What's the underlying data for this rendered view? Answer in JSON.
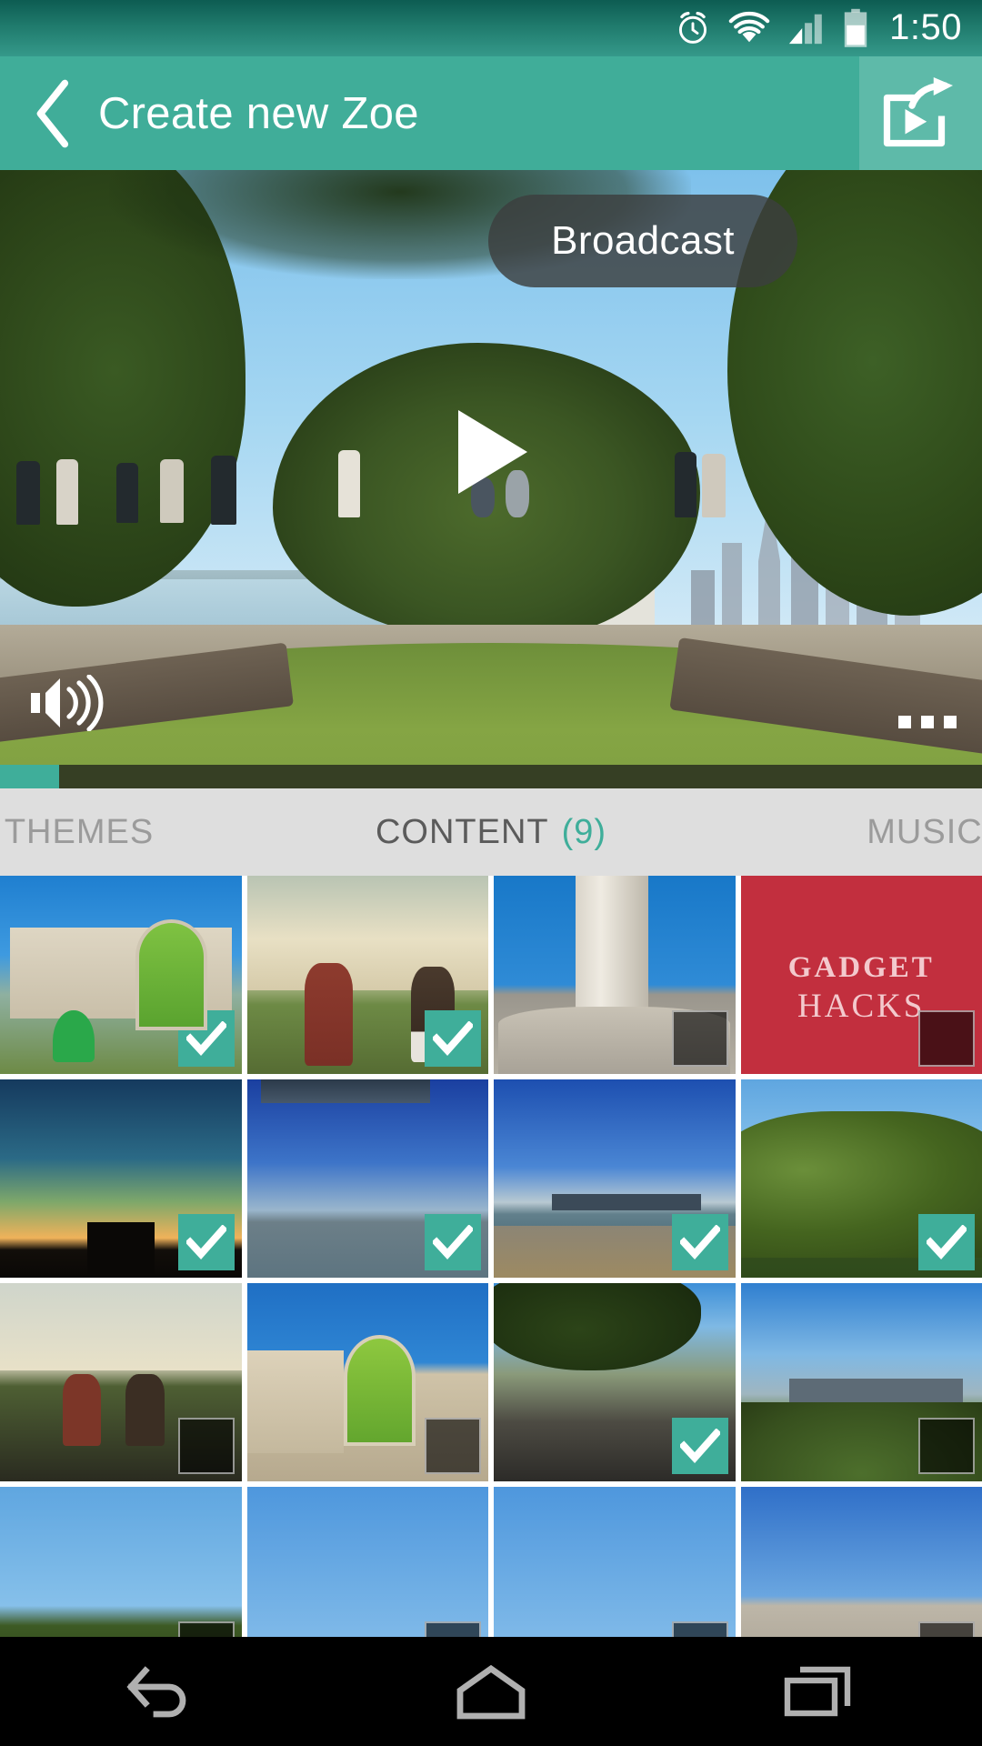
{
  "status_bar": {
    "time": "1:50",
    "icons": [
      "alarm-icon",
      "wifi-icon",
      "cellular-signal-icon",
      "battery-icon"
    ]
  },
  "action_bar": {
    "back_label": "back-arrow-icon",
    "title": "Create new Zoe",
    "broadcast_icon": "broadcast-share-icon"
  },
  "preview": {
    "tooltip": "Broadcast",
    "play_icon": "play-icon",
    "volume_icon": "volume-on-icon",
    "more_icon": "more-options-icon",
    "progress_percent": 6
  },
  "tabs": [
    {
      "label": "THEMES",
      "count": "",
      "selected": false
    },
    {
      "label": "CONTENT",
      "count": "(9)",
      "selected": true
    },
    {
      "label": "MUSIC",
      "count": "",
      "selected": false
    }
  ],
  "accent_color": "#3fae9a",
  "action_bar_color": "#40ad99",
  "grid": {
    "items": [
      {
        "name": "android-hq-green-droid",
        "scene": "t-hq",
        "selected": true
      },
      {
        "name": "kitkat-droid-statues",
        "scene": "t-droids",
        "selected": true
      },
      {
        "name": "coit-tower-monument",
        "scene": "t-monument",
        "selected": false
      },
      {
        "name": "gadget-hacks-logo",
        "scene": "t-gh",
        "selected": false
      },
      {
        "name": "night-sunset-skyline",
        "scene": "t-night",
        "selected": true
      },
      {
        "name": "san-francisco-bay-city",
        "scene": "t-city1",
        "selected": true
      },
      {
        "name": "bay-bridge-rocks-shore",
        "scene": "t-city2",
        "selected": true
      },
      {
        "name": "cypress-trees",
        "scene": "t-trees",
        "selected": true
      },
      {
        "name": "droid-statues-lawn",
        "scene": "t-droids2",
        "selected": false
      },
      {
        "name": "android-hq-entrance",
        "scene": "t-hq2",
        "selected": false
      },
      {
        "name": "tree-lined-street",
        "scene": "t-street",
        "selected": true
      },
      {
        "name": "city-skyline-hill",
        "scene": "t-skyline",
        "selected": false
      },
      {
        "name": "partial-row-item-1",
        "scene": "t-row4a",
        "selected": false
      },
      {
        "name": "partial-row-item-2",
        "scene": "t-row4b",
        "selected": false
      },
      {
        "name": "partial-row-item-3",
        "scene": "t-row4c",
        "selected": false
      },
      {
        "name": "partial-row-item-4",
        "scene": "t-row4d",
        "selected": false
      }
    ]
  },
  "nav_bar": {
    "back": "nav-back-icon",
    "home": "nav-home-icon",
    "recents": "nav-recents-icon"
  }
}
